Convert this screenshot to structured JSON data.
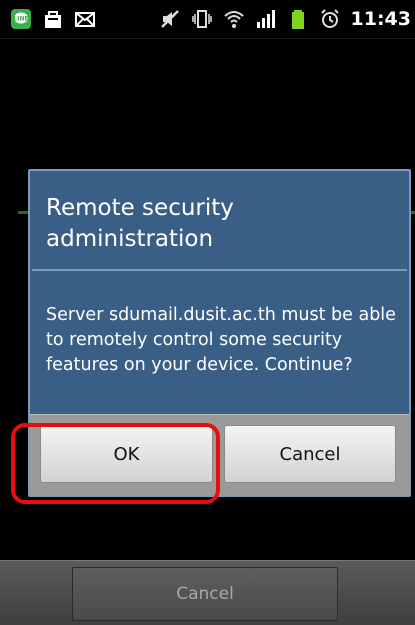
{
  "status_bar": {
    "time": "11:43",
    "icons_left": [
      "line-app-icon",
      "shopping-bag-icon",
      "mail-icon"
    ],
    "icons_right": [
      "mute-icon",
      "vibrate-icon",
      "wifi-icon",
      "signal-icon",
      "battery-icon",
      "alarm-icon"
    ]
  },
  "dialog": {
    "title": "Remote security administration",
    "message": "Server sdumail.dusit.ac.th must be able to remotely control some security features on your device. Continue?",
    "ok_label": "OK",
    "cancel_label": "Cancel"
  },
  "bottom": {
    "cancel_label": "Cancel"
  },
  "colors": {
    "dialog_bg": "#3a5f87",
    "highlight": "#e60e0e"
  }
}
